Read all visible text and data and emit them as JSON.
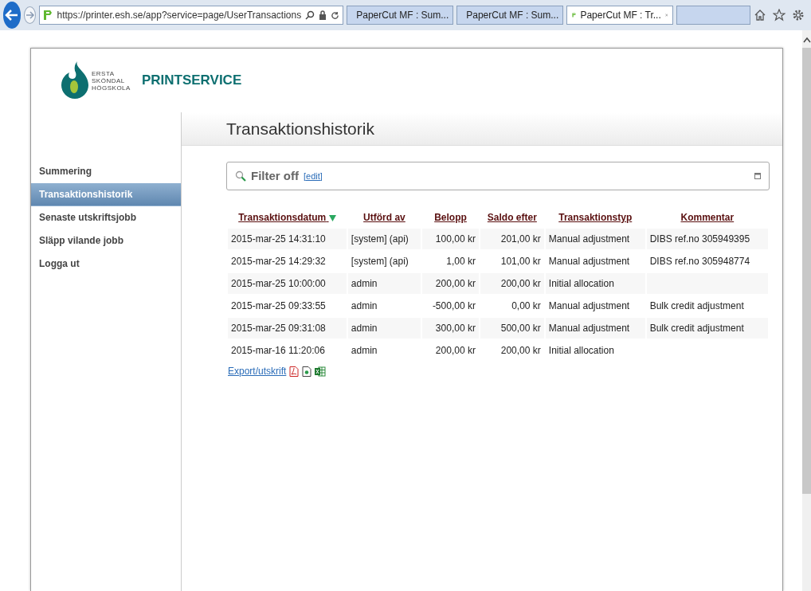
{
  "browser": {
    "url": "https://printer.esh.se/app?service=page/UserTransactions",
    "tabs": [
      {
        "label": "PaperCut MF : Sum...",
        "selected": false
      },
      {
        "label": "PaperCut MF : Sum...",
        "selected": false
      },
      {
        "label": "PaperCut MF : Tr...",
        "selected": true
      }
    ]
  },
  "header": {
    "logo_lines": [
      "ERSTA",
      "SKÖNDAL",
      "HÖGSKOLA"
    ],
    "site_title": "PRINTSERVICE"
  },
  "page_title": "Transaktionshistorik",
  "sidebar": {
    "items": [
      {
        "label": "Summering",
        "selected": false
      },
      {
        "label": "Transaktionshistorik",
        "selected": true
      },
      {
        "label": "Senaste utskriftsjobb",
        "selected": false
      },
      {
        "label": "Släpp vilande jobb",
        "selected": false
      },
      {
        "label": "Logga ut",
        "selected": false
      }
    ]
  },
  "filter": {
    "label": "Filter off",
    "edit_link": "[edit]"
  },
  "table": {
    "columns": [
      {
        "label": "Transaktionsdatum",
        "sorted": true
      },
      {
        "label": "Utförd av",
        "sorted": false
      },
      {
        "label": "Belopp",
        "sorted": false
      },
      {
        "label": "Saldo efter",
        "sorted": false
      },
      {
        "label": "Transaktionstyp",
        "sorted": false
      },
      {
        "label": "Kommentar",
        "sorted": false
      }
    ],
    "rows": [
      [
        "2015-mar-25 14:31:10",
        "[system] (api)",
        "100,00 kr",
        "201,00 kr",
        "Manual adjustment",
        "DIBS ref.no 305949395"
      ],
      [
        "2015-mar-25 14:29:32",
        "[system] (api)",
        "1,00 kr",
        "101,00 kr",
        "Manual adjustment",
        "DIBS ref.no 305948774"
      ],
      [
        "2015-mar-25 10:00:00",
        "admin",
        "200,00 kr",
        "200,00 kr",
        "Initial allocation",
        null
      ],
      [
        "2015-mar-25 09:33:55",
        "admin",
        "-500,00 kr",
        "0,00 kr",
        "Manual adjustment",
        "Bulk credit adjustment"
      ],
      [
        "2015-mar-25 09:31:08",
        "admin",
        "300,00 kr",
        "500,00 kr",
        "Manual adjustment",
        "Bulk credit adjustment"
      ],
      [
        "2015-mar-16 11:20:06",
        "admin",
        "200,00 kr",
        "200,00 kr",
        "Initial allocation",
        null
      ]
    ]
  },
  "export_link": "Export/utskrift"
}
